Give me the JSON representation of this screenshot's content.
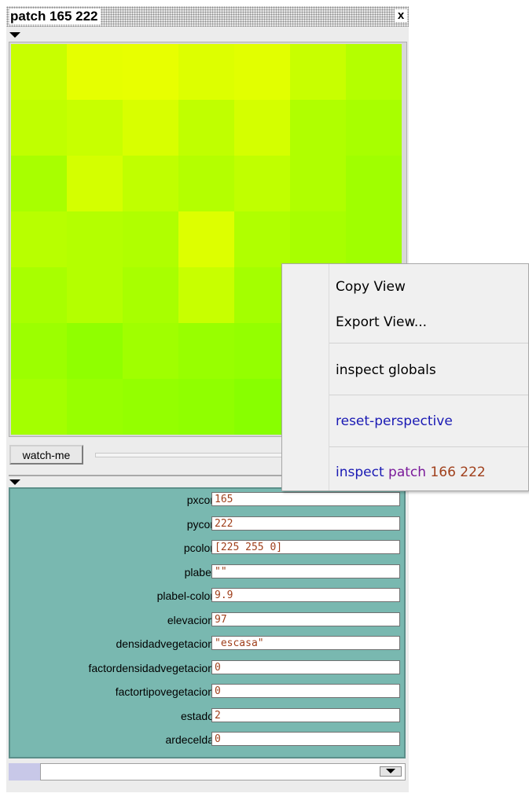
{
  "window": {
    "title": "patch 165 222",
    "close_glyph": "x"
  },
  "view": {
    "cell_colors": [
      "#c8ff00",
      "#e6ff00",
      "#e8ff00",
      "#ddff00",
      "#e2ff00",
      "#c8ff00",
      "#b4ff00",
      "#c0ff00",
      "#c8ff00",
      "#d8ff00",
      "#c0ff00",
      "#d4ff00",
      "#b0ff00",
      "#a8ff00",
      "#a8ff00",
      "#d4ff00",
      "#c0ff00",
      "#b4ff00",
      "#c0ff00",
      "#b0ff00",
      "#a0ff00",
      "#b8ff00",
      "#b4ff00",
      "#b0ff00",
      "#ddff00",
      "#b0ff00",
      "#a8ff00",
      "#a0ff00",
      "#a8ff00",
      "#b4ff00",
      "#a8ff00",
      "#c8ff00",
      "#a4ff00",
      "#a0ff00",
      "#98ff00",
      "#9cff00",
      "#90ff00",
      "#a0ff00",
      "#98ff00",
      "#94ff00",
      "#98ff00",
      "#9cff00",
      "#a4ff00",
      "#98ff00",
      "#94ff00",
      "#90ff00",
      "#88ff00",
      "#8cff00",
      "#90ff00"
    ]
  },
  "controls": {
    "watch_button": "watch-me"
  },
  "variables": [
    {
      "name": "pxcor",
      "value": "165"
    },
    {
      "name": "pycor",
      "value": "222"
    },
    {
      "name": "pcolor",
      "value": "[225 255 0]"
    },
    {
      "name": "plabel",
      "value": "\"\""
    },
    {
      "name": "plabel-color",
      "value": "9.9"
    },
    {
      "name": "elevacion",
      "value": "97"
    },
    {
      "name": "densidadvegetacion",
      "value": "\"escasa\""
    },
    {
      "name": "factordensidadvegetacion",
      "value": "0"
    },
    {
      "name": "factortipovegetacion",
      "value": "0"
    },
    {
      "name": "estado",
      "value": "2"
    },
    {
      "name": "ardecelda",
      "value": "0"
    }
  ],
  "context_menu": {
    "copy_view": "Copy View",
    "export_view": "Export View...",
    "inspect_globals": "inspect globals",
    "reset_perspective": "reset-perspective",
    "inspect_patch_word": "inspect",
    "inspect_patch_type": "patch",
    "inspect_patch_coords": "166 222",
    "colors": {
      "reset": "#1a1ab4",
      "inspect_word": "#1a1ab4",
      "patch_word": "#7a1a9a",
      "coords": "#a0401c"
    }
  }
}
